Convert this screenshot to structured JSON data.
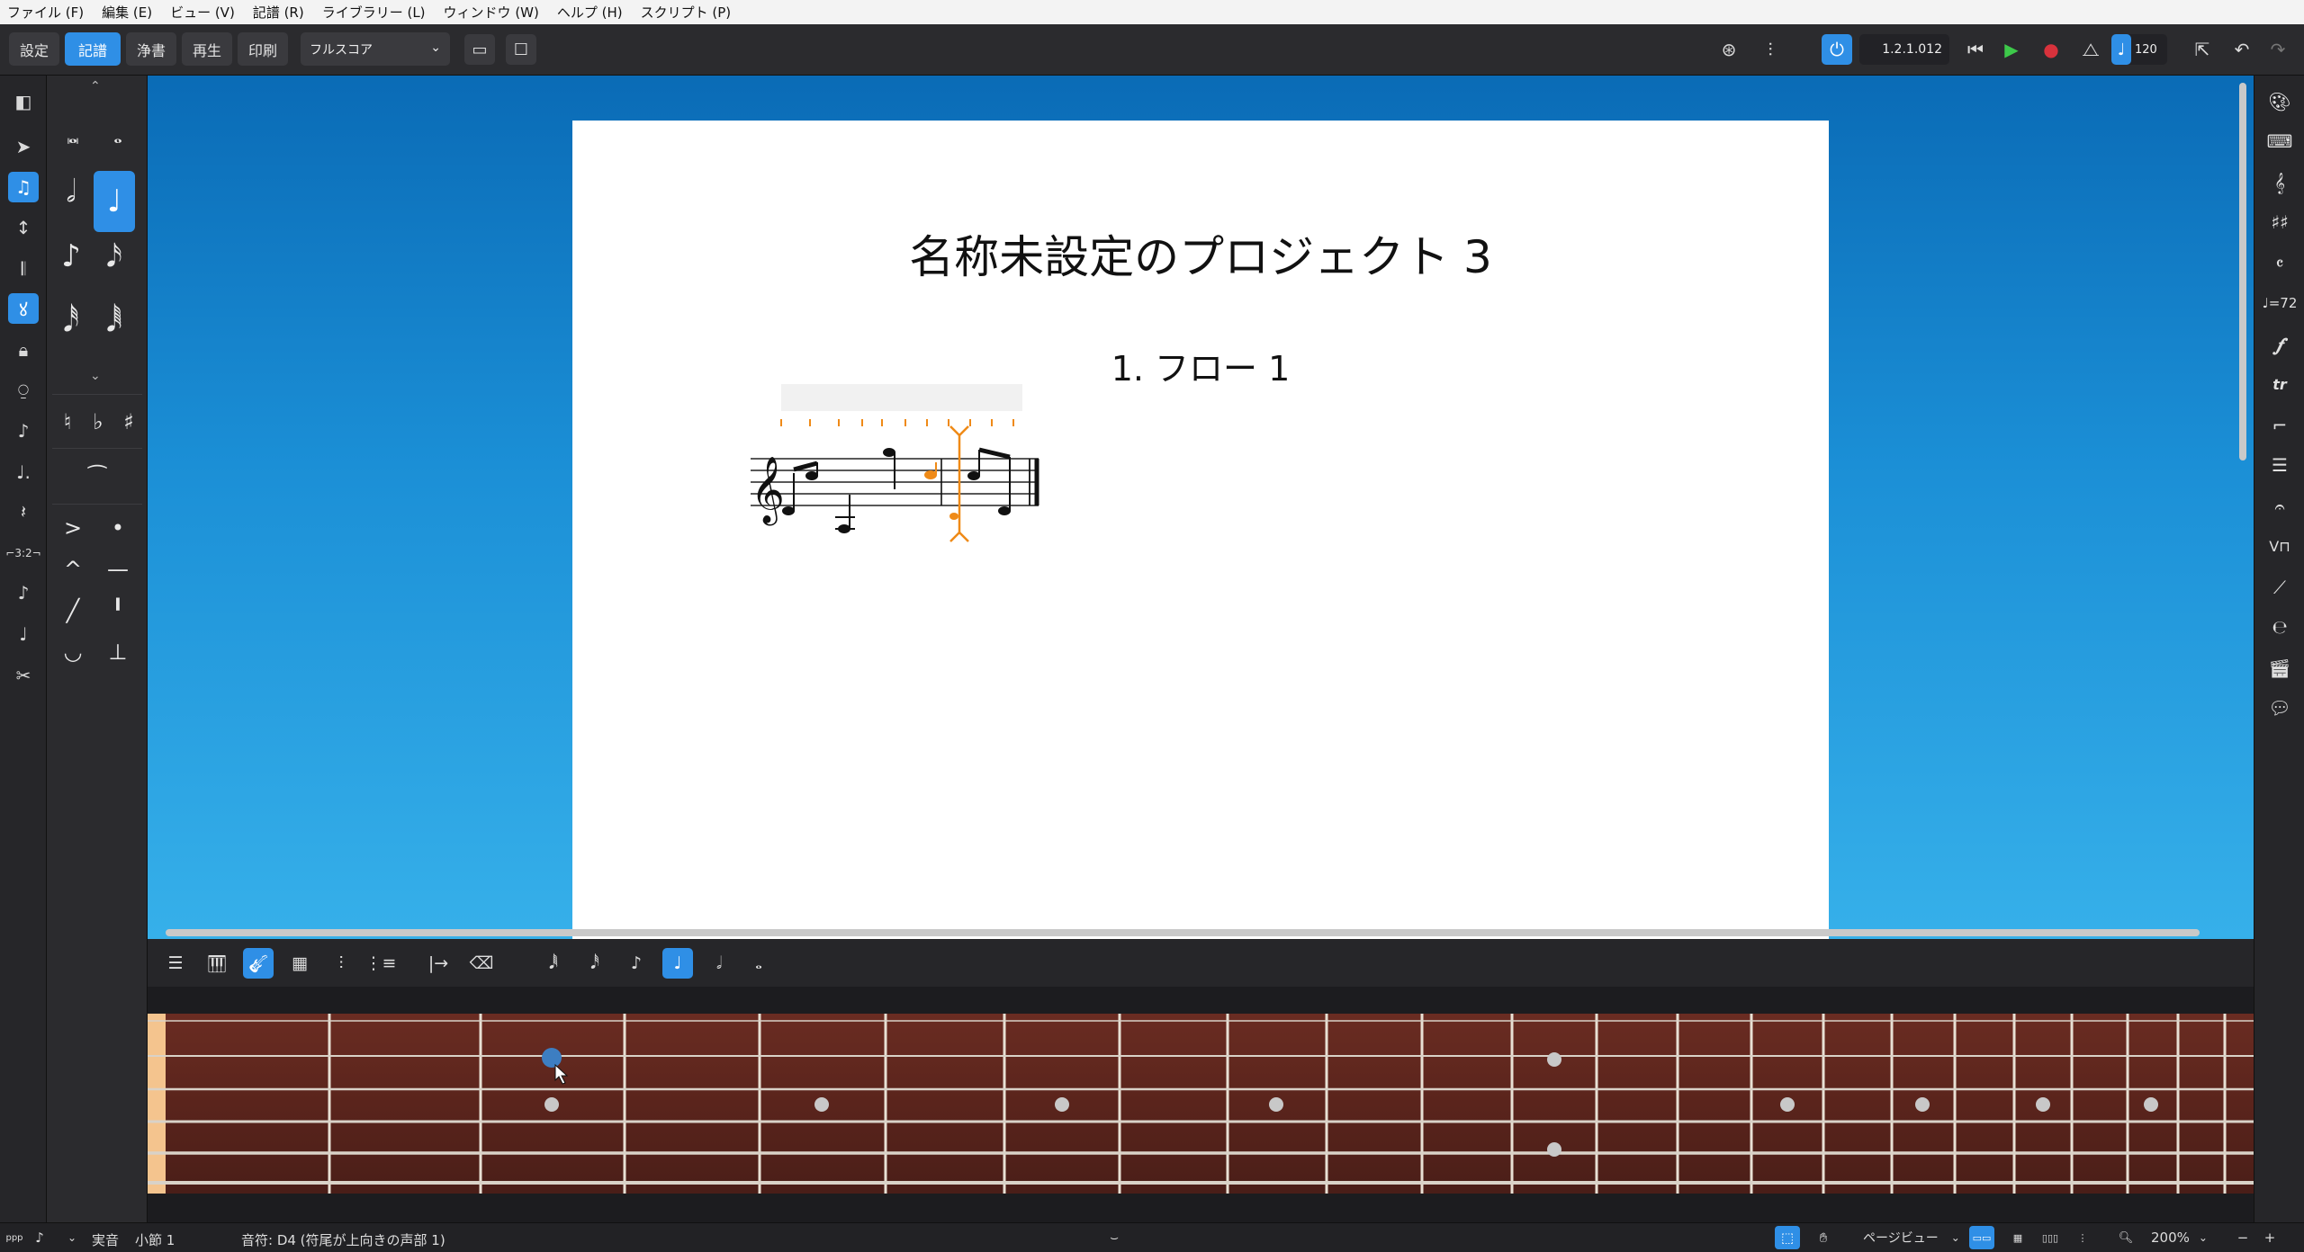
{
  "menu": [
    "ファイル (F)",
    "編集 (E)",
    "ビュー (V)",
    "記譜 (R)",
    "ライブラリー (L)",
    "ウィンドウ (W)",
    "ヘルプ (H)",
    "スクリプト (P)"
  ],
  "toolbar": {
    "modes": [
      "設定",
      "記譜",
      "浄書",
      "再生",
      "印刷"
    ],
    "active_mode": "記譜",
    "layout": "フルスコア",
    "timecode": "1.2.1.012",
    "tempo": "120"
  },
  "score": {
    "project_title": "名称未設定のプロジェクト 3",
    "flow_title": "1. フロー 1"
  },
  "statusbar": {
    "pitch_mode": "実音",
    "bar": "小節 1",
    "selection": "音符: D4 (符尾が上向きの声部 1)",
    "view": "ページビュー",
    "zoom": "200%"
  },
  "icons": {
    "left_strip": [
      "panel-toggle-icon",
      "select-arrow-icon",
      "note-input-icon",
      "drag-icon",
      "tremolo-icon",
      "grace-icon",
      "lock-icon",
      "microphone-icon",
      "chord-icon",
      "dotted-note-icon",
      "rest-icon",
      "tuplet-icon",
      "grace-note-icon",
      "slash-icon",
      "scissors-icon"
    ],
    "right_strip": [
      "palette-icon",
      "keyboard-icon",
      "clef-icon",
      "key-signature-icon",
      "time-signature-icon",
      "tempo-icon",
      "dynamics-icon",
      "ornaments-icon",
      "repeat-icon",
      "bar-icon",
      "fermata-icon",
      "bowing-icon",
      "line-icon",
      "playing-technique-icon",
      "video-icon",
      "comment-icon"
    ]
  },
  "colors": {
    "accent": "#2f8fe6",
    "caret": "#ef8a17",
    "fret_dot": "#c8c8c8",
    "selected_dot": "#3d7ec2"
  }
}
